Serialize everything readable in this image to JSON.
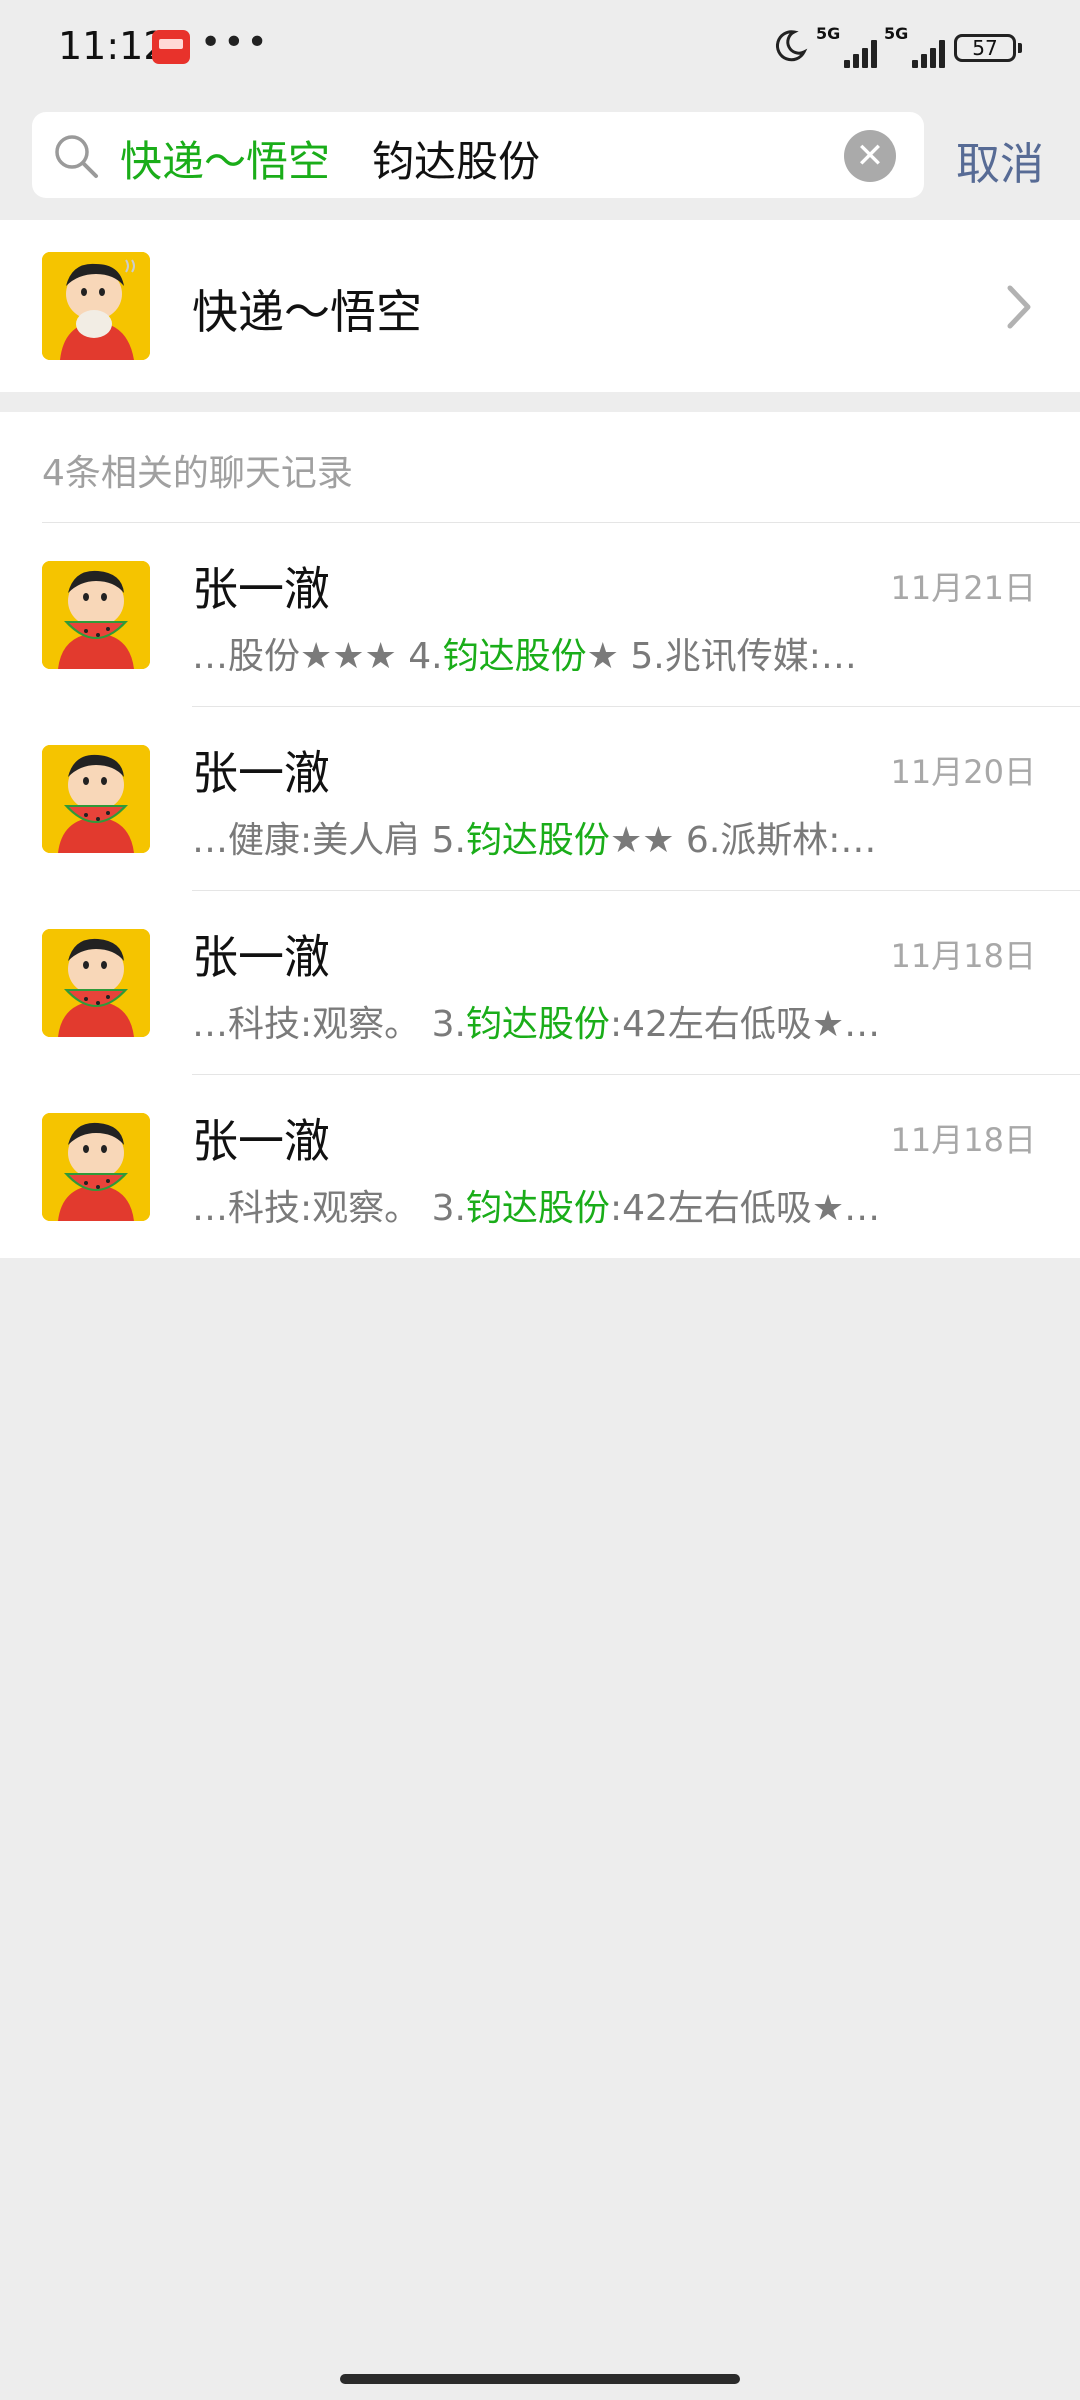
{
  "status_bar": {
    "time": "11:12",
    "overflow": "•••",
    "battery": "57",
    "network": [
      "5G",
      "5G"
    ]
  },
  "search": {
    "tag": "快递～悟空",
    "query": "钧达股份",
    "clear_icon": "close-icon",
    "cancel_label": "取消"
  },
  "contact": {
    "name": "快递～悟空"
  },
  "records": {
    "header": "4条相关的聊天记录",
    "items": [
      {
        "name": "张一澈",
        "date": "11月21日",
        "pre": "…股份★★★ 4.",
        "match": "钧达股份",
        "post": "★ 5.兆讯传媒:…"
      },
      {
        "name": "张一澈",
        "date": "11月20日",
        "pre": "…健康:美人肩 5.",
        "match": "钧达股份",
        "post": "★★ 6.派斯林:…"
      },
      {
        "name": "张一澈",
        "date": "11月18日",
        "pre": "…科技:观察。 3.",
        "match": "钧达股份",
        "post": ":42左右低吸★…"
      },
      {
        "name": "张一澈",
        "date": "11月18日",
        "pre": "…科技:观察。 3.",
        "match": "钧达股份",
        "post": ":42左右低吸★…"
      }
    ]
  },
  "colors": {
    "highlight": "#1aad19",
    "link": "#576b95",
    "avatar_bg": "#f5c400"
  }
}
